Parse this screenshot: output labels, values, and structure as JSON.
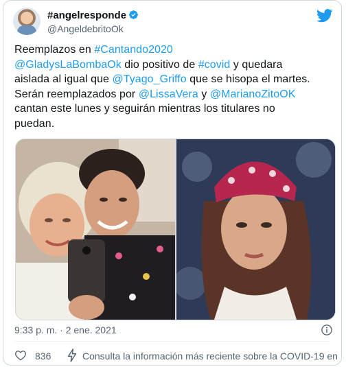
{
  "author": {
    "display_name": "#angelresponde",
    "handle": "@AngeldebritoOk"
  },
  "tweet": {
    "lines": [
      [
        {
          "text": "Reemplazos en ",
          "link": false
        },
        {
          "text": "#Cantando2020",
          "link": true
        }
      ],
      [
        {
          "text": "@GladysLaBombaOk",
          "link": true
        },
        {
          "text": " dio positivo de ",
          "link": false
        },
        {
          "text": "#covid",
          "link": true
        },
        {
          "text": " y quedara",
          "link": false
        }
      ],
      [
        {
          "text": "aislada al igual que ",
          "link": false
        },
        {
          "text": "@Tyago_Griffo",
          "link": true
        },
        {
          "text": " que se hisopa el martes.",
          "link": false
        }
      ],
      [
        {
          "text": "Serán reemplazados por ",
          "link": false
        },
        {
          "text": "@LissaVera",
          "link": true
        },
        {
          "text": " y ",
          "link": false
        },
        {
          "text": "@MarianoZitoOK",
          "link": true
        }
      ],
      [
        {
          "text": "cantan este lunes  y seguirán mientras los titulares no",
          "link": false
        }
      ],
      [
        {
          "text": "puedan.",
          "link": false
        }
      ]
    ]
  },
  "meta": {
    "timestamp": "9:33 p. m. · 2 ene. 2021"
  },
  "footer": {
    "likes": "836",
    "covid_notice": "Consulta la información más reciente sobre la COVID-19 en ..."
  },
  "colors": {
    "link": "#1d9bf0",
    "verified": "#1d9bf0",
    "text": "#0f1419",
    "muted": "#536471"
  },
  "icons": {
    "verified": "verified-badge-icon",
    "brand": "twitter-bird-icon",
    "info": "info-icon",
    "like": "heart-icon",
    "covid": "lightning-bolt-icon"
  }
}
